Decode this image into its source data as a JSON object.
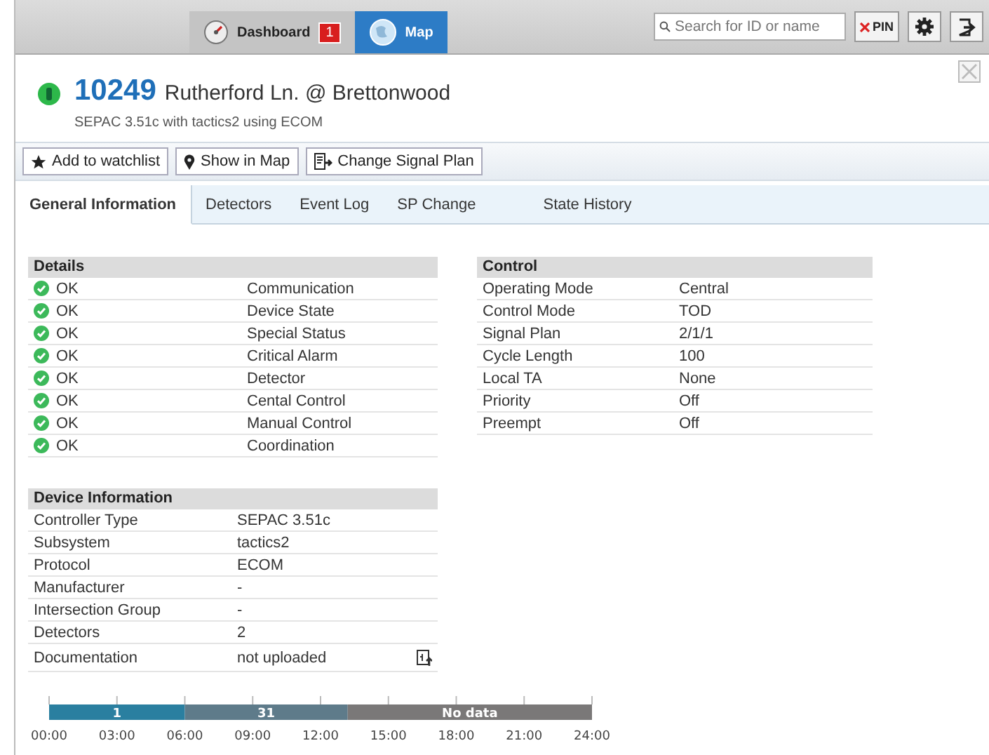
{
  "topbar": {
    "nav_tabs": [
      {
        "kind": "dashboard",
        "label": "Dashboard",
        "badge": "1",
        "selected": false
      },
      {
        "kind": "map",
        "label": "Map",
        "selected": true
      }
    ],
    "search": {
      "placeholder": "Search for ID or name"
    },
    "pin_button": "PIN"
  },
  "device": {
    "id": "10249",
    "name": "Rutherford Ln. @ Brettonwood",
    "subtitle": "SEPAC 3.51c with tactics2 using ECOM"
  },
  "actions": [
    {
      "kind": "watchlist",
      "label": "Add to watchlist"
    },
    {
      "kind": "map",
      "label": "Show in Map"
    },
    {
      "kind": "signal_plan",
      "label": "Change Signal Plan"
    }
  ],
  "tabs": [
    {
      "label": "General Information",
      "selected": true
    },
    {
      "label": "Detectors",
      "selected": false
    },
    {
      "label": "Event Log",
      "selected": false
    },
    {
      "label": "SP Change",
      "selected": false
    },
    {
      "label": "State History",
      "selected": false
    }
  ],
  "details": {
    "title": "Details",
    "rows": [
      {
        "status": "OK",
        "ok": true,
        "label": "Communication"
      },
      {
        "status": "OK",
        "ok": true,
        "label": "Device State"
      },
      {
        "status": "OK",
        "ok": true,
        "label": "Special Status"
      },
      {
        "status": "OK",
        "ok": true,
        "label": "Critical Alarm"
      },
      {
        "status": "OK",
        "ok": true,
        "label": "Detector"
      },
      {
        "status": "OK",
        "ok": true,
        "label": "Cental Control"
      },
      {
        "status": "OK",
        "ok": true,
        "label": "Manual Control"
      },
      {
        "status": "OK",
        "ok": true,
        "label": "Coordination"
      }
    ]
  },
  "control": {
    "title": "Control",
    "rows": [
      {
        "label": "Operating Mode",
        "value": "Central"
      },
      {
        "label": "Control Mode",
        "value": "TOD"
      },
      {
        "label": "Signal Plan",
        "value": "2/1/1"
      },
      {
        "label": "Cycle Length",
        "value": "100"
      },
      {
        "label": "Local TA",
        "value": "None"
      },
      {
        "label": "Priority",
        "value": "Off"
      },
      {
        "label": "Preempt",
        "value": "Off"
      }
    ]
  },
  "device_information": {
    "title": "Device Information",
    "rows": [
      {
        "kind": "text",
        "label": "Controller Type",
        "value": "SEPAC 3.51c"
      },
      {
        "kind": "text",
        "label": "Subsystem",
        "value": "tactics2"
      },
      {
        "kind": "text",
        "label": "Protocol",
        "value": "ECOM"
      },
      {
        "kind": "text",
        "label": "Manufacturer",
        "value": "-"
      },
      {
        "kind": "text",
        "label": "Intersection Group",
        "value": "-"
      },
      {
        "kind": "text",
        "label": "Detectors",
        "value": "2"
      },
      {
        "kind": "document",
        "label": "Documentation",
        "value": "not uploaded"
      }
    ]
  },
  "timeline": {
    "chart_data": {
      "type": "bar",
      "orientation": "horizontal",
      "stacked": true,
      "xlim": [
        0,
        24
      ],
      "xticks": [
        {
          "value": 0,
          "label": "00:00"
        },
        {
          "value": 3,
          "label": "03:00"
        },
        {
          "value": 6,
          "label": "06:00"
        },
        {
          "value": 9,
          "label": "09:00"
        },
        {
          "value": 12,
          "label": "12:00"
        },
        {
          "value": 15,
          "label": "15:00"
        },
        {
          "value": 18,
          "label": "18:00"
        },
        {
          "value": 21,
          "label": "21:00"
        },
        {
          "value": 24,
          "label": "24:00"
        }
      ],
      "series": [
        {
          "name": "1",
          "color": "#2a7fa0",
          "values": [
            6
          ]
        },
        {
          "name": "31",
          "color": "#5e7b8a",
          "values": [
            7.2
          ]
        },
        {
          "name": "No data",
          "color": "#7a7878",
          "values": [
            10.8
          ]
        }
      ]
    }
  }
}
